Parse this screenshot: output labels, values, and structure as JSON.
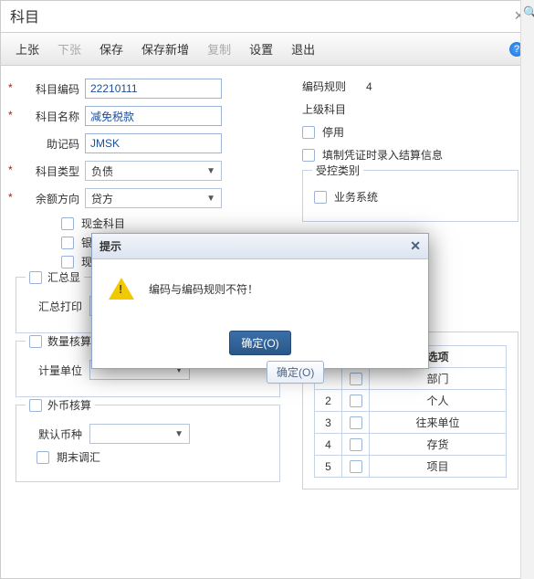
{
  "window": {
    "title": "科目"
  },
  "toolbar": {
    "prev": "上张",
    "next": "下张",
    "save": "保存",
    "save_new": "保存新增",
    "copy": "复制",
    "settings": "设置",
    "exit": "退出",
    "help_tip": "?"
  },
  "left": {
    "code_label": "科目编码",
    "code_value": "22210111",
    "name_label": "科目名称",
    "name_value": "减免税款",
    "mnemo_label": "助记码",
    "mnemo_value": "JMSK",
    "type_label": "科目类型",
    "type_value": "负债",
    "dir_label": "余额方向",
    "dir_value": "贷方",
    "chk_cash": "现金科目",
    "chk_bank": "银行",
    "chk_cashier": "现金",
    "sum_group": "汇总显",
    "sumprint_label": "汇总打印",
    "qty_group": "数量核算",
    "unit_label": "计量单位",
    "fx_group": "外币核算",
    "defccy_label": "默认币种",
    "period_adj": "期末调汇"
  },
  "right": {
    "rule_label": "编码规则",
    "rule_value": "4",
    "parent_label": "上级科目",
    "chk_disable": "停用",
    "chk_settle": "填制凭证时录入结算信息",
    "ctrl_group": "受控类别",
    "chk_biz": "业务系统",
    "aux_col1": "",
    "aux_col2": "",
    "aux_col3": "选项",
    "aux_rows": [
      {
        "n": "",
        "name": "部门"
      },
      {
        "n": "2",
        "name": "个人"
      },
      {
        "n": "3",
        "name": "往来单位"
      },
      {
        "n": "4",
        "name": "存货"
      },
      {
        "n": "5",
        "name": "项目"
      }
    ]
  },
  "modal": {
    "title": "提示",
    "message": "编码与编码规则不符！",
    "ok": "确定(O)"
  },
  "ghost_ok": "确定(O)"
}
